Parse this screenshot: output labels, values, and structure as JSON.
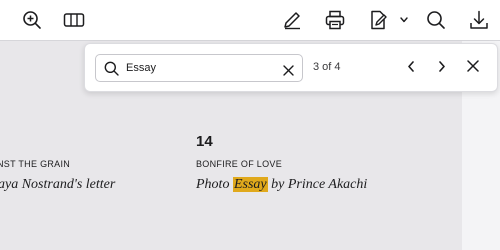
{
  "toolbar": {
    "icons": [
      "zoom-in-icon",
      "columns-icon",
      "pen-icon",
      "print-icon",
      "annotate-icon",
      "chevron-down-icon",
      "search-icon",
      "download-icon"
    ]
  },
  "document": {
    "left_column": {
      "kicker": "NST THE GRAIN",
      "title": "aya Nostrand's letter"
    },
    "right_column": {
      "page_number": "14",
      "kicker": "BONFIRE OF LOVE",
      "title_before": "Photo ",
      "title_highlight": "Essay",
      "title_after": " by Prince Akachi"
    },
    "highlight_color": "#e0a91c"
  },
  "find_bar": {
    "query": "Essay",
    "match_count": "3 of 4"
  }
}
